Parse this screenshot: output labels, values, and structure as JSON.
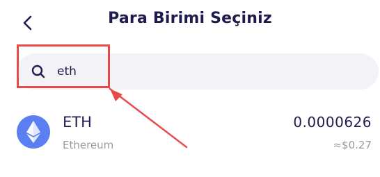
{
  "header": {
    "title": "Para Birimi Seçiniz",
    "back_icon": "chevron-left-icon"
  },
  "search": {
    "value": "eth",
    "icon": "search-icon"
  },
  "results": [
    {
      "symbol": "ETH",
      "name": "Ethereum",
      "amount": "0.0000626",
      "fiat_value": "≈$0.27",
      "logo_icon": "ethereum-icon",
      "logo_color": "#5b7ef0"
    }
  ],
  "annotation": {
    "color": "#e84a4a"
  }
}
